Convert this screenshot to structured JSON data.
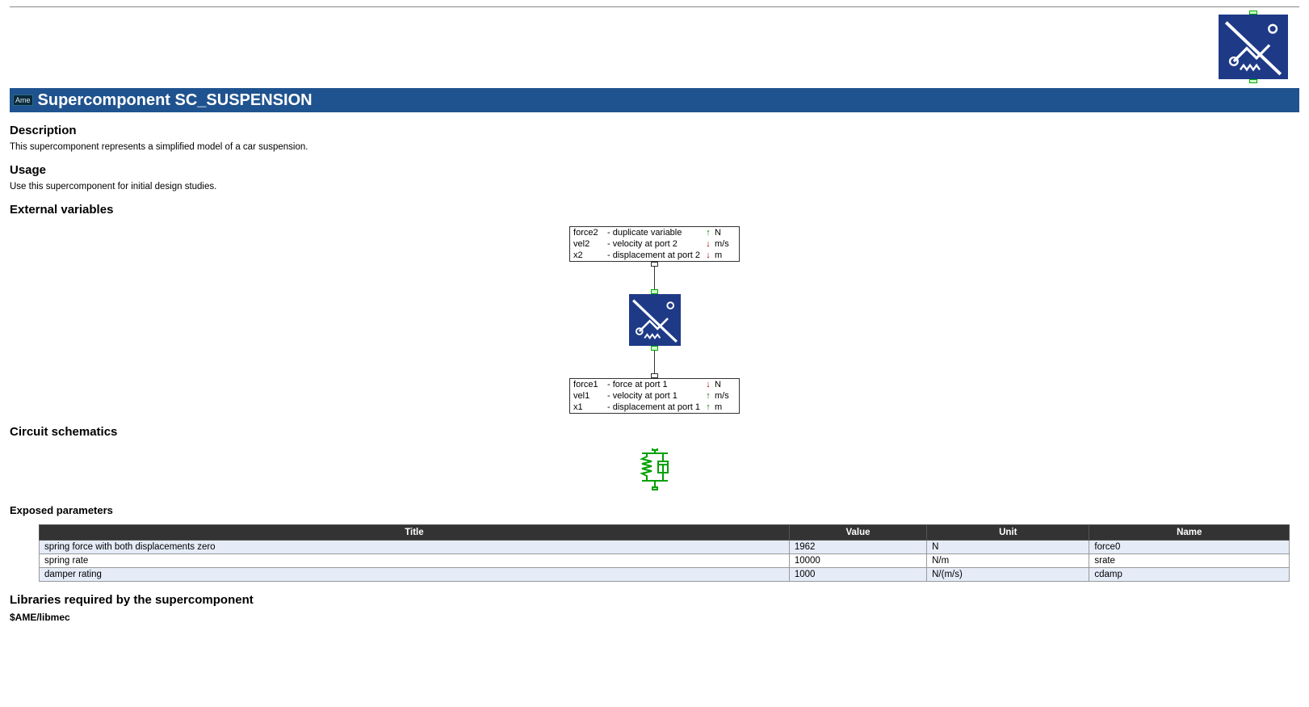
{
  "header": {
    "tag_label": "Ame",
    "title": "Supercomponent SC_SUSPENSION"
  },
  "sections": {
    "description_heading": "Description",
    "description_text": "This supercomponent represents a simplified model of a car suspension.",
    "usage_heading": "Usage",
    "usage_text": "Use this supercomponent for initial design studies.",
    "extvar_heading": "External variables",
    "circuit_heading": "Circuit schematics",
    "params_heading": "Exposed parameters",
    "libs_heading": "Libraries required by the supercomponent"
  },
  "ext_vars_top": [
    {
      "name": "force2",
      "sep": "-",
      "desc": "duplicate variable",
      "dir": "up",
      "unit": "N"
    },
    {
      "name": "vel2",
      "sep": "-",
      "desc": "velocity at port 2",
      "dir": "down",
      "unit": "m/s"
    },
    {
      "name": "x2",
      "sep": "-",
      "desc": "displacement at port 2",
      "dir": "down",
      "unit": "m"
    }
  ],
  "ext_vars_bottom": [
    {
      "name": "force1",
      "sep": "-",
      "desc": "force at port 1",
      "dir": "down",
      "unit": "N"
    },
    {
      "name": "vel1",
      "sep": "-",
      "desc": "velocity at port 1",
      "dir": "up",
      "unit": "m/s"
    },
    {
      "name": "x1",
      "sep": "-",
      "desc": "displacement at port 1",
      "dir": "up",
      "unit": "m"
    }
  ],
  "param_table": {
    "headers": {
      "title": "Title",
      "value": "Value",
      "unit": "Unit",
      "name": "Name"
    },
    "rows": [
      {
        "title": "spring force with both displacements zero",
        "value": "1962",
        "unit": "N",
        "name": "force0"
      },
      {
        "title": "spring rate",
        "value": "10000",
        "unit": "N/m",
        "name": "srate"
      },
      {
        "title": "damper rating",
        "value": "1000",
        "unit": "N/(m/s)",
        "name": "cdamp"
      }
    ]
  },
  "libraries": [
    "$AME/libmec"
  ],
  "icons": {
    "component_alt": "suspension-component-icon",
    "schematic_alt": "spring-damper-schematic-icon"
  }
}
